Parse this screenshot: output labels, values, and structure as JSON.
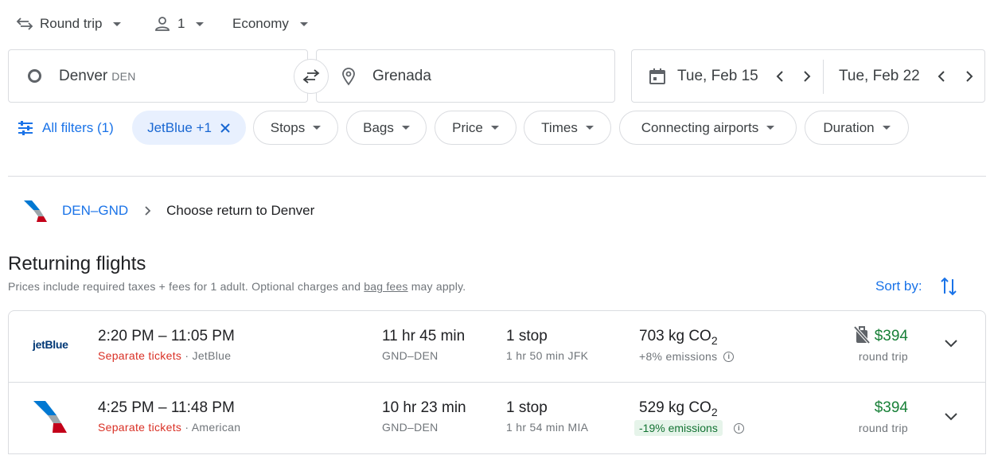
{
  "trip_options": {
    "trip_type": "Round trip",
    "passengers": "1",
    "cabin_class": "Economy"
  },
  "search": {
    "origin_city": "Denver",
    "origin_code": "DEN",
    "destination": "Grenada",
    "depart_date": "Tue, Feb 15",
    "return_date": "Tue, Feb 22"
  },
  "filters": {
    "all_filters": "All filters (1)",
    "airline_chip": "JetBlue +1",
    "chips": [
      "Stops",
      "Bags",
      "Price",
      "Times",
      "Connecting airports",
      "Duration"
    ]
  },
  "breadcrumb": {
    "route": "DEN–GND",
    "current": "Choose return to Denver"
  },
  "results": {
    "heading": "Returning flights",
    "note_before": "Prices include required taxes + fees for 1 adult. Optional charges and ",
    "note_link": "bag fees",
    "note_after": " may apply.",
    "sort_label": "Sort by:"
  },
  "flights": [
    {
      "airline_logo_text": "jetBlue",
      "times": "2:20 PM – 11:05 PM",
      "ticket_note": "Separate tickets",
      "airline": "JetBlue",
      "duration": "11 hr 45 min",
      "route": "GND–DEN",
      "stops": "1 stop",
      "layover": "1 hr 50 min JFK",
      "emissions": "703 kg CO",
      "emissions_sub": "2",
      "emissions_delta": "+8% emissions",
      "price": "$394",
      "price_note": "round trip"
    },
    {
      "airline_logo_text": "",
      "times": "4:25 PM – 11:48 PM",
      "ticket_note": "Separate tickets",
      "airline": "American",
      "duration": "10 hr 23 min",
      "route": "GND–DEN",
      "stops": "1 stop",
      "layover": "1 hr 54 min MIA",
      "emissions": "529 kg CO",
      "emissions_sub": "2",
      "emissions_delta": "-19% emissions",
      "price": "$394",
      "price_note": "round trip"
    }
  ],
  "colors": {
    "accent": "#1a73e8",
    "price_green": "#188038",
    "separate_red": "#d93025",
    "chip_active_bg": "#e8f0fe"
  }
}
